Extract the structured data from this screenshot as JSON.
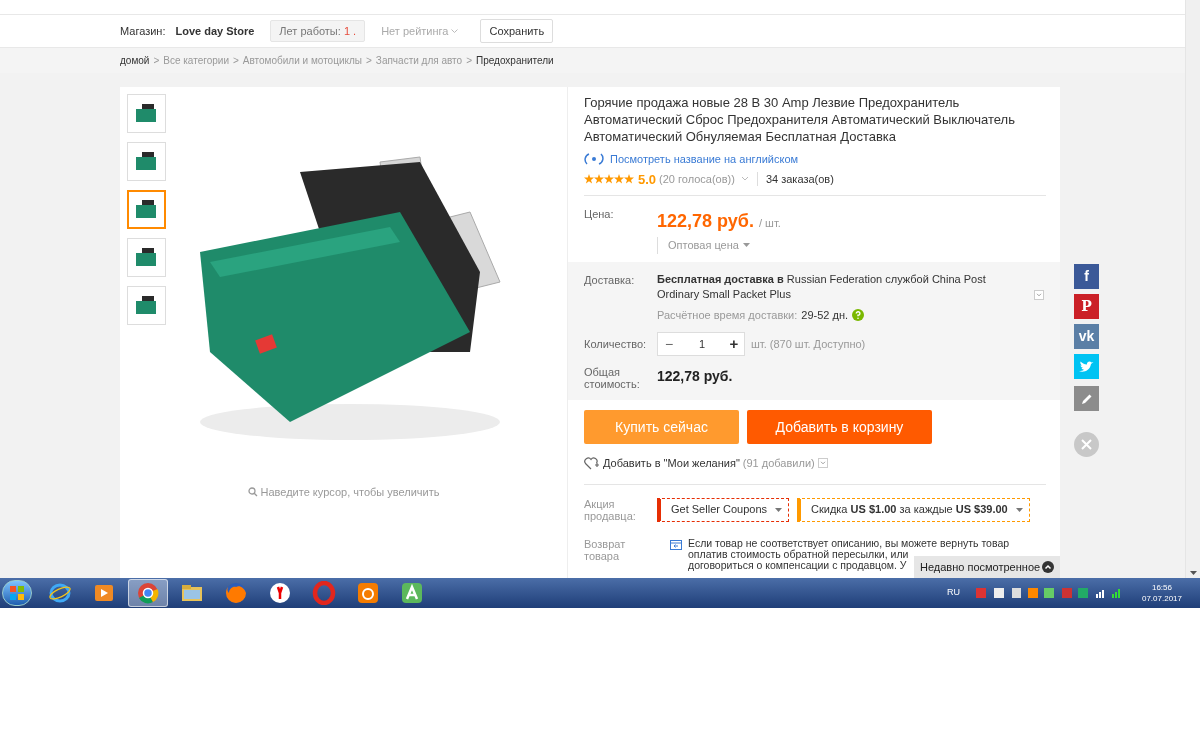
{
  "store_bar": {
    "label": "Магазин:",
    "store_name": "Love day Store",
    "years_label": "Лет работы:",
    "years_value": "1 .",
    "rating": "Нет рейтинга",
    "save_button": "Сохранить"
  },
  "breadcrumbs": [
    "домой",
    "Все категории",
    "Автомобили и мотоциклы",
    "Запчасти для авто",
    "Предохранители"
  ],
  "breadcrumb_separator": ">",
  "gallery": {
    "thumbnails": [
      {
        "selected": false
      },
      {
        "selected": false
      },
      {
        "selected": true
      },
      {
        "selected": false
      },
      {
        "selected": false
      }
    ],
    "zoom_hint": "Наведите курсор, чтобы увеличить"
  },
  "product": {
    "title": "Горячие продажа новые 28 В 30 Amp Лезвие Предохранитель Автоматический Сброс Предохранителя Автоматический Выключатель Автоматический Обнуляемая Бесплатная Доставка",
    "translate_link": "Посмотреть название на английском",
    "stars": 5,
    "rating": "5.0",
    "votes": "(20 голоса(ов))",
    "orders": "34 заказа(ов)",
    "price_label": "Цена:",
    "price": "122,78 руб.",
    "price_unit": "/ шт.",
    "wholesale": "Оптовая цена",
    "delivery_label": "Доставка:",
    "delivery": "**Бесплатная доставка в** Russian Federation службой China Post Ordinary Small Packet Plus",
    "delivery_time_label": "Расчётное время доставки:",
    "delivery_time": "29-52 дн.",
    "quantity_label": "Количество:",
    "quantity": "1",
    "minus": "−",
    "plus": "+",
    "availability": "шт. (870 шт. Доступно)",
    "total_label": "Общая стоимость:",
    "total": "122,78 руб.",
    "buy_button": "Купить сейчас",
    "cart_button": "Добавить в корзину",
    "wishlist": "Добавить в \"Мои желания\"",
    "wishlist_count": "(91 добавили)",
    "promo_label": "Акция продавца:",
    "coupons": [
      {
        "text": "Get Seller Coupons",
        "color": "#e62e04"
      },
      {
        "text": "Скидка **US $1.00** за каждые **US $39.00**",
        "color": "#ff9900"
      }
    ],
    "return_label": "Возврат товара",
    "return_lines": [
      "Если товар не соответствует описанию, вы можете вернуть товар",
      "оплатив стоимость обратной пересылки, или",
      "договориться о компенсации с продавцом. У"
    ]
  },
  "share_buttons": [
    {
      "kind": "facebook",
      "glyph": "f",
      "color": "#3b5998"
    },
    {
      "kind": "pinterest",
      "glyph": "P",
      "color": "#cb2027"
    },
    {
      "kind": "vk",
      "glyph": "vk",
      "color": "#5b7fa6"
    },
    {
      "kind": "twitter",
      "color": "#00c3f3"
    }
  ],
  "recently_viewed": "Недавно посмотренное",
  "taskbar": {
    "apps": [
      {
        "kind": "ie",
        "selected": false
      },
      {
        "kind": "media",
        "selected": false
      },
      {
        "kind": "chrome",
        "selected": true
      },
      {
        "kind": "folder",
        "selected": false
      },
      {
        "kind": "firefox",
        "selected": false
      },
      {
        "kind": "yandex",
        "selected": false
      },
      {
        "kind": "opera",
        "selected": false
      },
      {
        "kind": "uc",
        "selected": false
      },
      {
        "kind": "a",
        "selected": false
      }
    ],
    "language": "RU",
    "time": "16:56",
    "date": "07.07.2017"
  }
}
